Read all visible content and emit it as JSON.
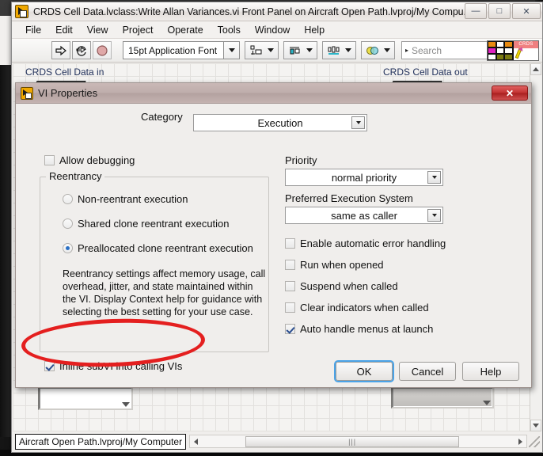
{
  "window": {
    "title": "CRDS Cell Data.lvclass:Write Allan Variances.vi Front Panel on Aircraft Open Path.lvproj/My Compu...",
    "icon": "labview-vi-icon",
    "buttons": {
      "minimize": "—",
      "maximize": "□",
      "close": "✕"
    }
  },
  "menubar": {
    "items": [
      "File",
      "Edit",
      "View",
      "Project",
      "Operate",
      "Tools",
      "Window",
      "Help"
    ]
  },
  "toolbar": {
    "run_icon": "run-arrow-icon",
    "run_continuous_icon": "run-continuously-icon",
    "abort_icon": "abort-execution-icon",
    "font": "15pt Application Font",
    "align_icon": "align-objects-icon",
    "distribute_icon": "distribute-objects-icon",
    "resize_icon": "resize-objects-icon",
    "reorder_icon": "reorder-objects-icon",
    "search_placeholder": "Search",
    "search_value": "",
    "help_label": "?",
    "vi_icon_label": "CRDS"
  },
  "front_panel": {
    "label_in": "CRDS Cell Data in",
    "label_out": "CRDS Cell Data out"
  },
  "statusbar": {
    "path": "Aircraft Open Path.lvproj/My Computer",
    "hscroll_grip": "|||"
  },
  "dialog": {
    "title": "VI Properties",
    "icon": "labview-vi-icon",
    "close_label": "✕",
    "category": {
      "label": "Category",
      "value": "Execution"
    },
    "left": {
      "allow_debugging": {
        "label": "Allow debugging",
        "checked": false
      },
      "reentrancy": {
        "title": "Reentrancy",
        "options": [
          {
            "label": "Non-reentrant execution",
            "selected": false
          },
          {
            "label": "Shared clone reentrant execution",
            "selected": false
          },
          {
            "label": "Preallocated clone reentrant execution",
            "selected": true
          }
        ],
        "description": "Reentrancy settings affect memory usage, call overhead, jitter, and state maintained within the VI. Display Context help for guidance with selecting the best setting for your use case."
      },
      "inline_subvi": {
        "label": "Inline subVI into calling VIs",
        "checked": true
      }
    },
    "right": {
      "priority": {
        "label": "Priority",
        "value": "normal priority"
      },
      "exec_system": {
        "label": "Preferred Execution System",
        "value": "same as caller"
      },
      "checkboxes": [
        {
          "label": "Enable automatic error handling",
          "checked": false
        },
        {
          "label": "Run when opened",
          "checked": false
        },
        {
          "label": "Suspend when called",
          "checked": false
        },
        {
          "label": "Clear indicators when called",
          "checked": false
        },
        {
          "label": "Auto handle menus at launch",
          "checked": true
        }
      ]
    },
    "buttons": {
      "ok": "OK",
      "cancel": "Cancel",
      "help": "Help"
    }
  },
  "annotation": {
    "shape": "red-ellipse-highlight",
    "color": "#e41f1f"
  }
}
